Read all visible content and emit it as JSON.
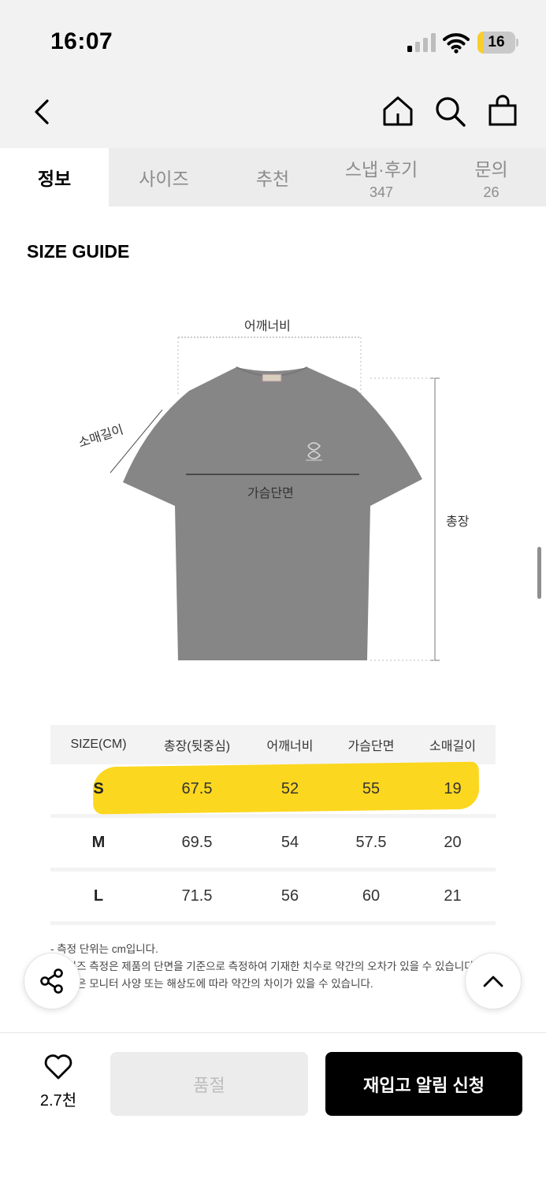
{
  "status_bar": {
    "time": "16:07",
    "battery_level": "16",
    "battery_fraction": 0.16,
    "battery_color": "#f7ce2c"
  },
  "tabs": [
    {
      "label": "정보",
      "count": ""
    },
    {
      "label": "사이즈",
      "count": ""
    },
    {
      "label": "추천",
      "count": ""
    },
    {
      "label": "스냅·후기",
      "count": "347"
    },
    {
      "label": "문의",
      "count": "26"
    }
  ],
  "size_guide": {
    "title": "SIZE GUIDE",
    "labels": {
      "shoulder": "어깨너비",
      "sleeve": "소매길이",
      "chest": "가슴단면",
      "length": "총장"
    },
    "shirt_color": "#868686"
  },
  "size_table": {
    "headers": [
      "SIZE(CM)",
      "총장(뒷중심)",
      "어깨너비",
      "가슴단면",
      "소매길이"
    ],
    "rows": [
      [
        "S",
        "67.5",
        "52",
        "55",
        "19"
      ],
      [
        "M",
        "69.5",
        "54",
        "57.5",
        "20"
      ],
      [
        "L",
        "71.5",
        "56",
        "60",
        "21"
      ]
    ],
    "highlighted_row": "S",
    "highlight_color": "#fcd200"
  },
  "notes": [
    "- 측정 단위는 cm입니다.",
    "- 사이즈 측정은 제품의 단면을 기준으로 측정하여 기재한 치수로 약간의 오차가 있을 수 있습니다.",
    "- 색상은 모니터 사양 또는 해상도에 따라 약간의 차이가 있을 수 있습니다."
  ],
  "bottom_bar": {
    "like_count": "2.7천",
    "soldout_label": "품절",
    "restock_label": "재입고 알림 신청"
  },
  "icons": [
    "back-icon",
    "home-icon",
    "search-icon",
    "bag-icon",
    "share-icon",
    "chevron-up-icon",
    "heart-icon",
    "signal-icon",
    "wifi-icon",
    "battery-icon"
  ]
}
